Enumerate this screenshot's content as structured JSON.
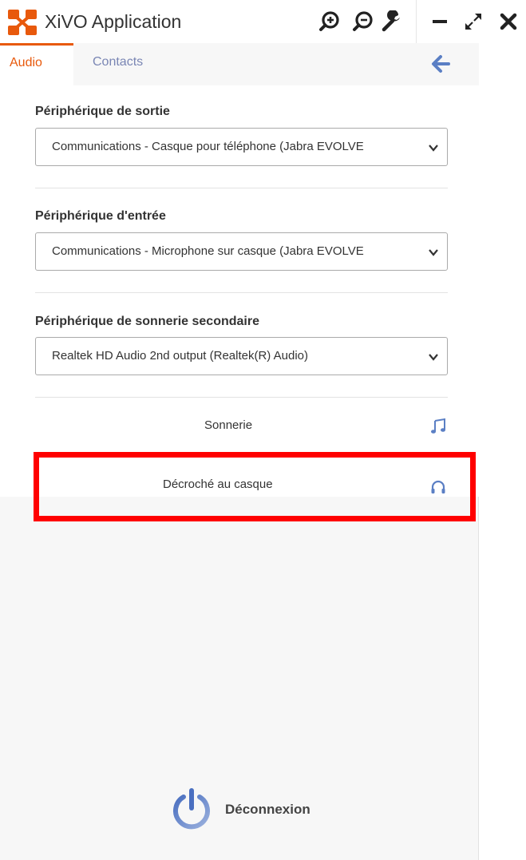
{
  "window": {
    "title": "XiVO Application",
    "toolbar": [
      "zoom-in-icon",
      "zoom-out-icon",
      "wrench-icon",
      "minimize-icon",
      "expand-icon",
      "close-icon"
    ]
  },
  "tabs": [
    {
      "label": "Audio",
      "active": true
    },
    {
      "label": "Contacts",
      "active": false
    }
  ],
  "audio": {
    "output": {
      "label": "Périphérique de sortie",
      "selected": "Communications - Casque pour téléphone (Jabra EVOLVE"
    },
    "input": {
      "label": "Périphérique d'entrée",
      "selected": "Communications - Microphone sur casque (Jabra EVOLVE"
    },
    "ring": {
      "label": "Périphérique de sonnerie secondaire",
      "selected": "Realtek HD Audio 2nd output (Realtek(R) Audio)"
    },
    "sonnerie": {
      "label": "Sonnerie",
      "icon": "music-note-icon"
    },
    "decroche": {
      "label": "Décroché au casque",
      "icon": "headphones-icon"
    }
  },
  "footer": {
    "logout_label": "Déconnexion",
    "icon": "power-icon"
  },
  "colors": {
    "accent": "#e8590c",
    "tab_inactive": "#7a86b4",
    "icon_blue": "#5b7fc4",
    "highlight": "#ff0000"
  }
}
